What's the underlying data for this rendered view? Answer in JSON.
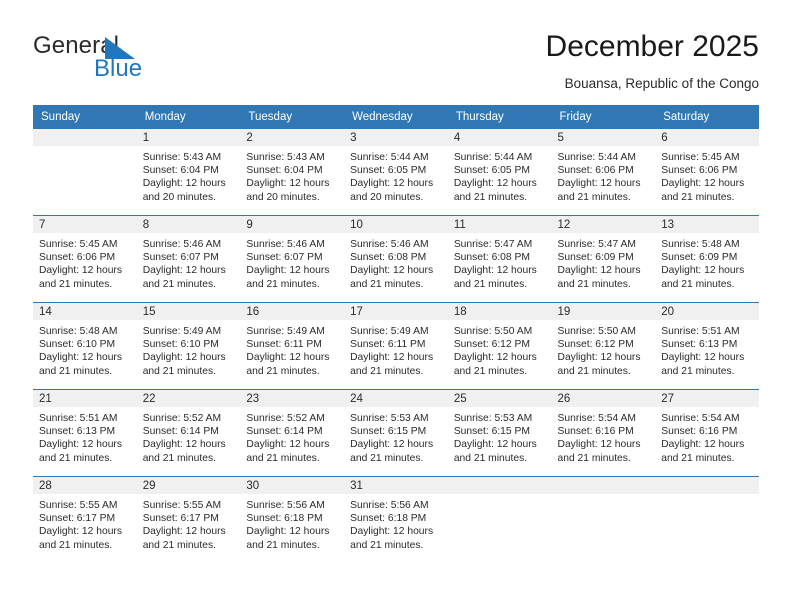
{
  "brand": {
    "name_top": "General",
    "name_bottom": "Blue",
    "accent_color": "#1f77bd",
    "triangle_icon": "triangle-icon"
  },
  "header": {
    "month_title": "December 2025",
    "location": "Bouansa, Republic of the Congo"
  },
  "calendar": {
    "header_bg": "#3077b4",
    "daynum_bg": "#f0f0f0",
    "weekday_headers": [
      "Sunday",
      "Monday",
      "Tuesday",
      "Wednesday",
      "Thursday",
      "Friday",
      "Saturday"
    ],
    "weeks": [
      [
        {
          "day": "",
          "empty": true,
          "sunrise": "",
          "sunset": "",
          "daylight": ""
        },
        {
          "day": "1",
          "sunrise": "Sunrise: 5:43 AM",
          "sunset": "Sunset: 6:04 PM",
          "daylight": "Daylight: 12 hours and 20 minutes."
        },
        {
          "day": "2",
          "sunrise": "Sunrise: 5:43 AM",
          "sunset": "Sunset: 6:04 PM",
          "daylight": "Daylight: 12 hours and 20 minutes."
        },
        {
          "day": "3",
          "sunrise": "Sunrise: 5:44 AM",
          "sunset": "Sunset: 6:05 PM",
          "daylight": "Daylight: 12 hours and 20 minutes."
        },
        {
          "day": "4",
          "sunrise": "Sunrise: 5:44 AM",
          "sunset": "Sunset: 6:05 PM",
          "daylight": "Daylight: 12 hours and 21 minutes."
        },
        {
          "day": "5",
          "sunrise": "Sunrise: 5:44 AM",
          "sunset": "Sunset: 6:06 PM",
          "daylight": "Daylight: 12 hours and 21 minutes."
        },
        {
          "day": "6",
          "sunrise": "Sunrise: 5:45 AM",
          "sunset": "Sunset: 6:06 PM",
          "daylight": "Daylight: 12 hours and 21 minutes."
        }
      ],
      [
        {
          "day": "7",
          "sunrise": "Sunrise: 5:45 AM",
          "sunset": "Sunset: 6:06 PM",
          "daylight": "Daylight: 12 hours and 21 minutes."
        },
        {
          "day": "8",
          "sunrise": "Sunrise: 5:46 AM",
          "sunset": "Sunset: 6:07 PM",
          "daylight": "Daylight: 12 hours and 21 minutes."
        },
        {
          "day": "9",
          "sunrise": "Sunrise: 5:46 AM",
          "sunset": "Sunset: 6:07 PM",
          "daylight": "Daylight: 12 hours and 21 minutes."
        },
        {
          "day": "10",
          "sunrise": "Sunrise: 5:46 AM",
          "sunset": "Sunset: 6:08 PM",
          "daylight": "Daylight: 12 hours and 21 minutes."
        },
        {
          "day": "11",
          "sunrise": "Sunrise: 5:47 AM",
          "sunset": "Sunset: 6:08 PM",
          "daylight": "Daylight: 12 hours and 21 minutes."
        },
        {
          "day": "12",
          "sunrise": "Sunrise: 5:47 AM",
          "sunset": "Sunset: 6:09 PM",
          "daylight": "Daylight: 12 hours and 21 minutes."
        },
        {
          "day": "13",
          "sunrise": "Sunrise: 5:48 AM",
          "sunset": "Sunset: 6:09 PM",
          "daylight": "Daylight: 12 hours and 21 minutes."
        }
      ],
      [
        {
          "day": "14",
          "sunrise": "Sunrise: 5:48 AM",
          "sunset": "Sunset: 6:10 PM",
          "daylight": "Daylight: 12 hours and 21 minutes."
        },
        {
          "day": "15",
          "sunrise": "Sunrise: 5:49 AM",
          "sunset": "Sunset: 6:10 PM",
          "daylight": "Daylight: 12 hours and 21 minutes."
        },
        {
          "day": "16",
          "sunrise": "Sunrise: 5:49 AM",
          "sunset": "Sunset: 6:11 PM",
          "daylight": "Daylight: 12 hours and 21 minutes."
        },
        {
          "day": "17",
          "sunrise": "Sunrise: 5:49 AM",
          "sunset": "Sunset: 6:11 PM",
          "daylight": "Daylight: 12 hours and 21 minutes."
        },
        {
          "day": "18",
          "sunrise": "Sunrise: 5:50 AM",
          "sunset": "Sunset: 6:12 PM",
          "daylight": "Daylight: 12 hours and 21 minutes."
        },
        {
          "day": "19",
          "sunrise": "Sunrise: 5:50 AM",
          "sunset": "Sunset: 6:12 PM",
          "daylight": "Daylight: 12 hours and 21 minutes."
        },
        {
          "day": "20",
          "sunrise": "Sunrise: 5:51 AM",
          "sunset": "Sunset: 6:13 PM",
          "daylight": "Daylight: 12 hours and 21 minutes."
        }
      ],
      [
        {
          "day": "21",
          "sunrise": "Sunrise: 5:51 AM",
          "sunset": "Sunset: 6:13 PM",
          "daylight": "Daylight: 12 hours and 21 minutes."
        },
        {
          "day": "22",
          "sunrise": "Sunrise: 5:52 AM",
          "sunset": "Sunset: 6:14 PM",
          "daylight": "Daylight: 12 hours and 21 minutes."
        },
        {
          "day": "23",
          "sunrise": "Sunrise: 5:52 AM",
          "sunset": "Sunset: 6:14 PM",
          "daylight": "Daylight: 12 hours and 21 minutes."
        },
        {
          "day": "24",
          "sunrise": "Sunrise: 5:53 AM",
          "sunset": "Sunset: 6:15 PM",
          "daylight": "Daylight: 12 hours and 21 minutes."
        },
        {
          "day": "25",
          "sunrise": "Sunrise: 5:53 AM",
          "sunset": "Sunset: 6:15 PM",
          "daylight": "Daylight: 12 hours and 21 minutes."
        },
        {
          "day": "26",
          "sunrise": "Sunrise: 5:54 AM",
          "sunset": "Sunset: 6:16 PM",
          "daylight": "Daylight: 12 hours and 21 minutes."
        },
        {
          "day": "27",
          "sunrise": "Sunrise: 5:54 AM",
          "sunset": "Sunset: 6:16 PM",
          "daylight": "Daylight: 12 hours and 21 minutes."
        }
      ],
      [
        {
          "day": "28",
          "sunrise": "Sunrise: 5:55 AM",
          "sunset": "Sunset: 6:17 PM",
          "daylight": "Daylight: 12 hours and 21 minutes."
        },
        {
          "day": "29",
          "sunrise": "Sunrise: 5:55 AM",
          "sunset": "Sunset: 6:17 PM",
          "daylight": "Daylight: 12 hours and 21 minutes."
        },
        {
          "day": "30",
          "sunrise": "Sunrise: 5:56 AM",
          "sunset": "Sunset: 6:18 PM",
          "daylight": "Daylight: 12 hours and 21 minutes."
        },
        {
          "day": "31",
          "sunrise": "Sunrise: 5:56 AM",
          "sunset": "Sunset: 6:18 PM",
          "daylight": "Daylight: 12 hours and 21 minutes."
        },
        {
          "day": "",
          "empty": true,
          "sunrise": "",
          "sunset": "",
          "daylight": ""
        },
        {
          "day": "",
          "empty": true,
          "sunrise": "",
          "sunset": "",
          "daylight": ""
        },
        {
          "day": "",
          "empty": true,
          "sunrise": "",
          "sunset": "",
          "daylight": ""
        }
      ]
    ]
  }
}
